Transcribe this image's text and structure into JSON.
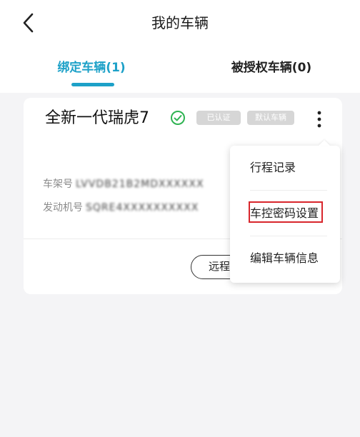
{
  "header": {
    "title": "我的车辆",
    "back_icon": "chevron-left-icon"
  },
  "tabs": [
    {
      "label": "绑定车辆(1)",
      "active": true
    },
    {
      "label": "被授权车辆(0)",
      "active": false
    }
  ],
  "colors": {
    "accent": "#1da1c8",
    "verified_green": "#2fb352",
    "highlight_red": "#d8262c",
    "badge_gray": "#d6d6d6"
  },
  "vehicle": {
    "name": "全新一代瑞虎7",
    "badges": {
      "verified": "已认证",
      "default": "默认车辆"
    },
    "vin_label": "车架号",
    "vin_value": "LVVDB21B2MDXXXXXX",
    "engine_label": "发动机号",
    "engine_value": "SQRE4XXXXXXXXXX",
    "remote_button": "远程控制"
  },
  "menu": {
    "items": [
      {
        "label": "行程记录"
      },
      {
        "label": "车控密码设置",
        "highlighted": true
      },
      {
        "label": "编辑车辆信息"
      }
    ]
  }
}
